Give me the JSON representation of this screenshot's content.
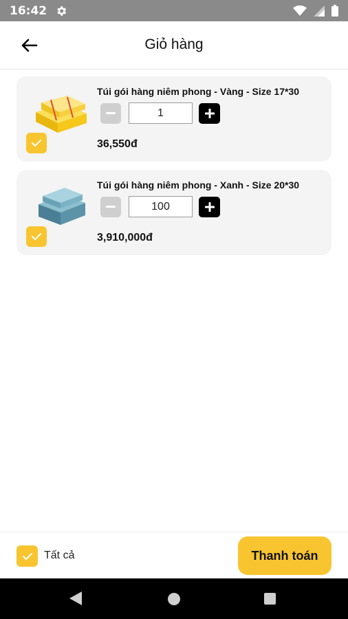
{
  "status_bar": {
    "time": "16:42",
    "icons": [
      "gear-icon",
      "wifi-icon",
      "signal-icon",
      "battery-icon"
    ]
  },
  "header": {
    "title": "Giỏ hàng",
    "back_icon": "arrow-left-icon"
  },
  "cart": {
    "items": [
      {
        "name": "Túi gói hàng niêm phong - Vàng - Size 17*30",
        "quantity": "1",
        "price": "36,550đ",
        "checked": true,
        "image_color": "#f6c81c"
      },
      {
        "name": "Túi gói hàng niêm phong - Xanh - Size 20*30",
        "quantity": "100",
        "price": "3,910,000đ",
        "checked": true,
        "image_color": "#5b93a8"
      }
    ]
  },
  "footer": {
    "select_all_label": "Tất cả",
    "select_all_checked": true,
    "checkout_label": "Thanh toán"
  },
  "colors": {
    "accent": "#f8c530",
    "card_bg": "#f4f4f4",
    "status_bar": "#8a8a8a"
  },
  "nav_bar": {
    "icons": [
      "nav-back-icon",
      "nav-home-icon",
      "nav-recents-icon"
    ]
  }
}
